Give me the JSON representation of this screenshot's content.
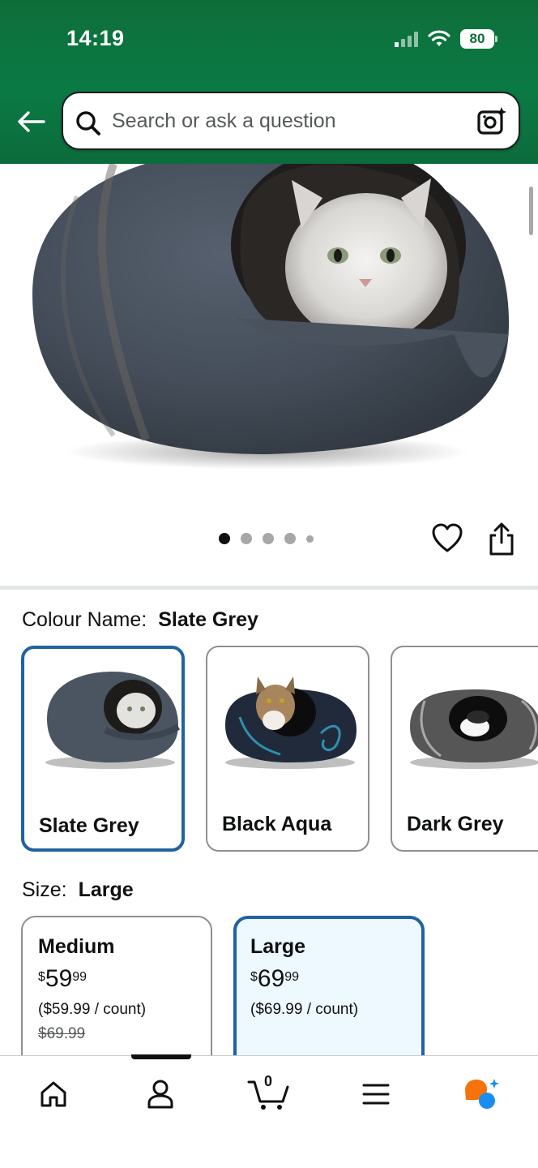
{
  "status_bar": {
    "time": "14:19",
    "battery": "80"
  },
  "search": {
    "placeholder": "Search or ask a question"
  },
  "gallery": {
    "image_count": 5,
    "active_index": 0
  },
  "colour": {
    "label": "Colour Name:",
    "selected": "Slate Grey",
    "options": [
      {
        "name": "Slate Grey",
        "selected": true
      },
      {
        "name": "Black Aqua",
        "selected": false
      },
      {
        "name": "Dark Grey",
        "selected": false
      }
    ]
  },
  "size": {
    "label": "Size:",
    "selected": "Large",
    "options": [
      {
        "name": "Medium",
        "currency": "$",
        "whole": "59",
        "fraction": "99",
        "unit_price": "($59.99 / count)",
        "list_price": "$69.99",
        "selected": false
      },
      {
        "name": "Large",
        "currency": "$",
        "whole": "69",
        "fraction": "99",
        "unit_price": "($69.99 / count)",
        "selected": true
      }
    ]
  },
  "bottom_nav": {
    "cart_count": "0",
    "items": [
      "home-icon",
      "account-icon",
      "cart-icon",
      "menu-icon",
      "rufus-icon"
    ]
  },
  "colors": {
    "header_green": "#0a7a44",
    "selected_border": "#2162a1",
    "selected_bg": "#edf8ff"
  }
}
